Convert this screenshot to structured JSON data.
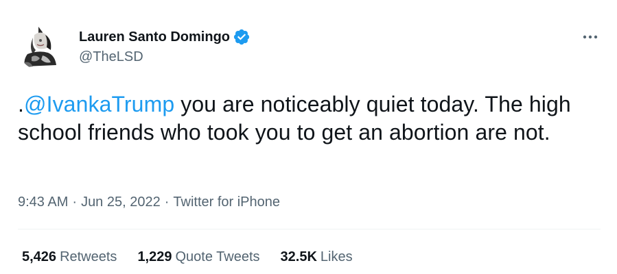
{
  "author": {
    "display_name": "Lauren Santo Domingo",
    "handle": "@TheLSD",
    "verified": true,
    "avatar_icon": "profile-photo"
  },
  "tweet": {
    "prefix": ".",
    "mention": "@IvankaTrump",
    "text": " you are noticeably quiet today. The high school friends who took you to get an abortion are not."
  },
  "meta": {
    "time": "9:43 AM",
    "separator": "·",
    "date": "Jun 25, 2022",
    "source": "Twitter for iPhone"
  },
  "stats": [
    {
      "count": "5,426",
      "label": "Retweets"
    },
    {
      "count": "1,229",
      "label": "Quote Tweets"
    },
    {
      "count": "32.5K",
      "label": "Likes"
    }
  ],
  "colors": {
    "link": "#1d9bf0",
    "secondary_text": "#536471",
    "primary_text": "#0f1419",
    "verified_badge": "#1d9bf0",
    "divider": "#eff3f4"
  }
}
